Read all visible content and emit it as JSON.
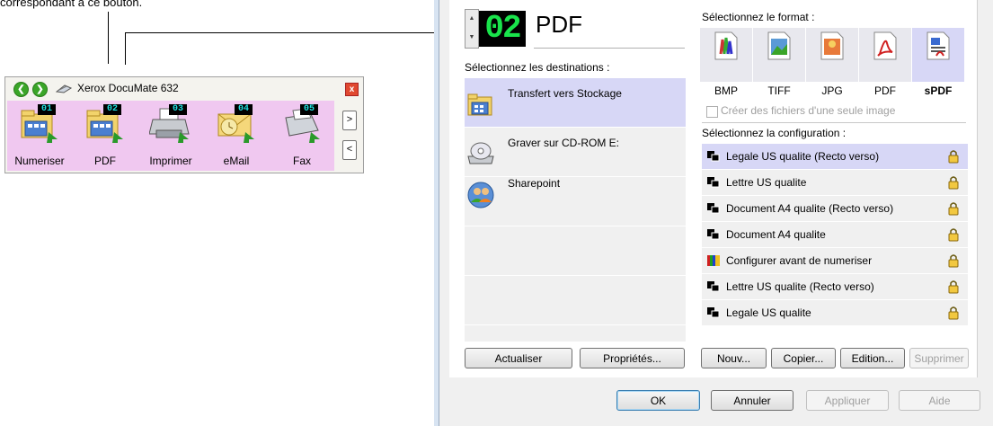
{
  "caption": "correspondant à ce bouton.",
  "onetouch": {
    "title": "Xerox DocuMate 632",
    "back_icon": "back-arrow-icon",
    "forward_icon": "forward-arrow-icon",
    "close_label": "x",
    "next_label": ">",
    "prev_label": "<",
    "buttons": [
      {
        "number": "01",
        "label": "Numeriser",
        "icon": "folder-icon"
      },
      {
        "number": "02",
        "label": "PDF",
        "icon": "folder-icon"
      },
      {
        "number": "03",
        "label": "Imprimer",
        "icon": "printer-icon"
      },
      {
        "number": "04",
        "label": "eMail",
        "icon": "email-icon"
      },
      {
        "number": "05",
        "label": "Fax",
        "icon": "fax-icon"
      }
    ]
  },
  "dialog": {
    "button_number": "02",
    "button_name": "PDF",
    "destinations_label": "Sélectionnez les destinations :",
    "destinations": [
      {
        "label": "Transfert vers Stockage",
        "selected": true
      },
      {
        "label": "Graver sur CD-ROM  E:",
        "selected": false
      },
      {
        "label": "Sharepoint",
        "selected": false
      }
    ],
    "format_label": "Sélectionnez le format :",
    "formats": [
      {
        "label": "BMP",
        "selected": false
      },
      {
        "label": "TIFF",
        "selected": false
      },
      {
        "label": "JPG",
        "selected": false
      },
      {
        "label": "PDF",
        "selected": false
      },
      {
        "label": "sPDF",
        "selected": true
      }
    ],
    "single_image_label": "Créer des fichiers d'une seule image",
    "config_label": "Sélectionnez la configuration :",
    "configs": [
      {
        "label": "Legale US qualite (Recto verso)",
        "selected": true
      },
      {
        "label": "Lettre US qualite",
        "selected": false
      },
      {
        "label": "Document A4 qualite (Recto verso)",
        "selected": false
      },
      {
        "label": "Document A4 qualite",
        "selected": false
      },
      {
        "label": "Configurer avant de numeriser",
        "selected": false
      },
      {
        "label": "Lettre US qualite (Recto verso)",
        "selected": false
      },
      {
        "label": "Legale US qualite",
        "selected": false
      }
    ],
    "refresh_label": "Actualiser",
    "properties_label": "Propriétés...",
    "new_label": "Nouv...",
    "copy_label": "Copier...",
    "edit_label": "Edition...",
    "delete_label": "Supprimer",
    "ok_label": "OK",
    "cancel_label": "Annuler",
    "apply_label": "Appliquer",
    "help_label": "Aide"
  }
}
